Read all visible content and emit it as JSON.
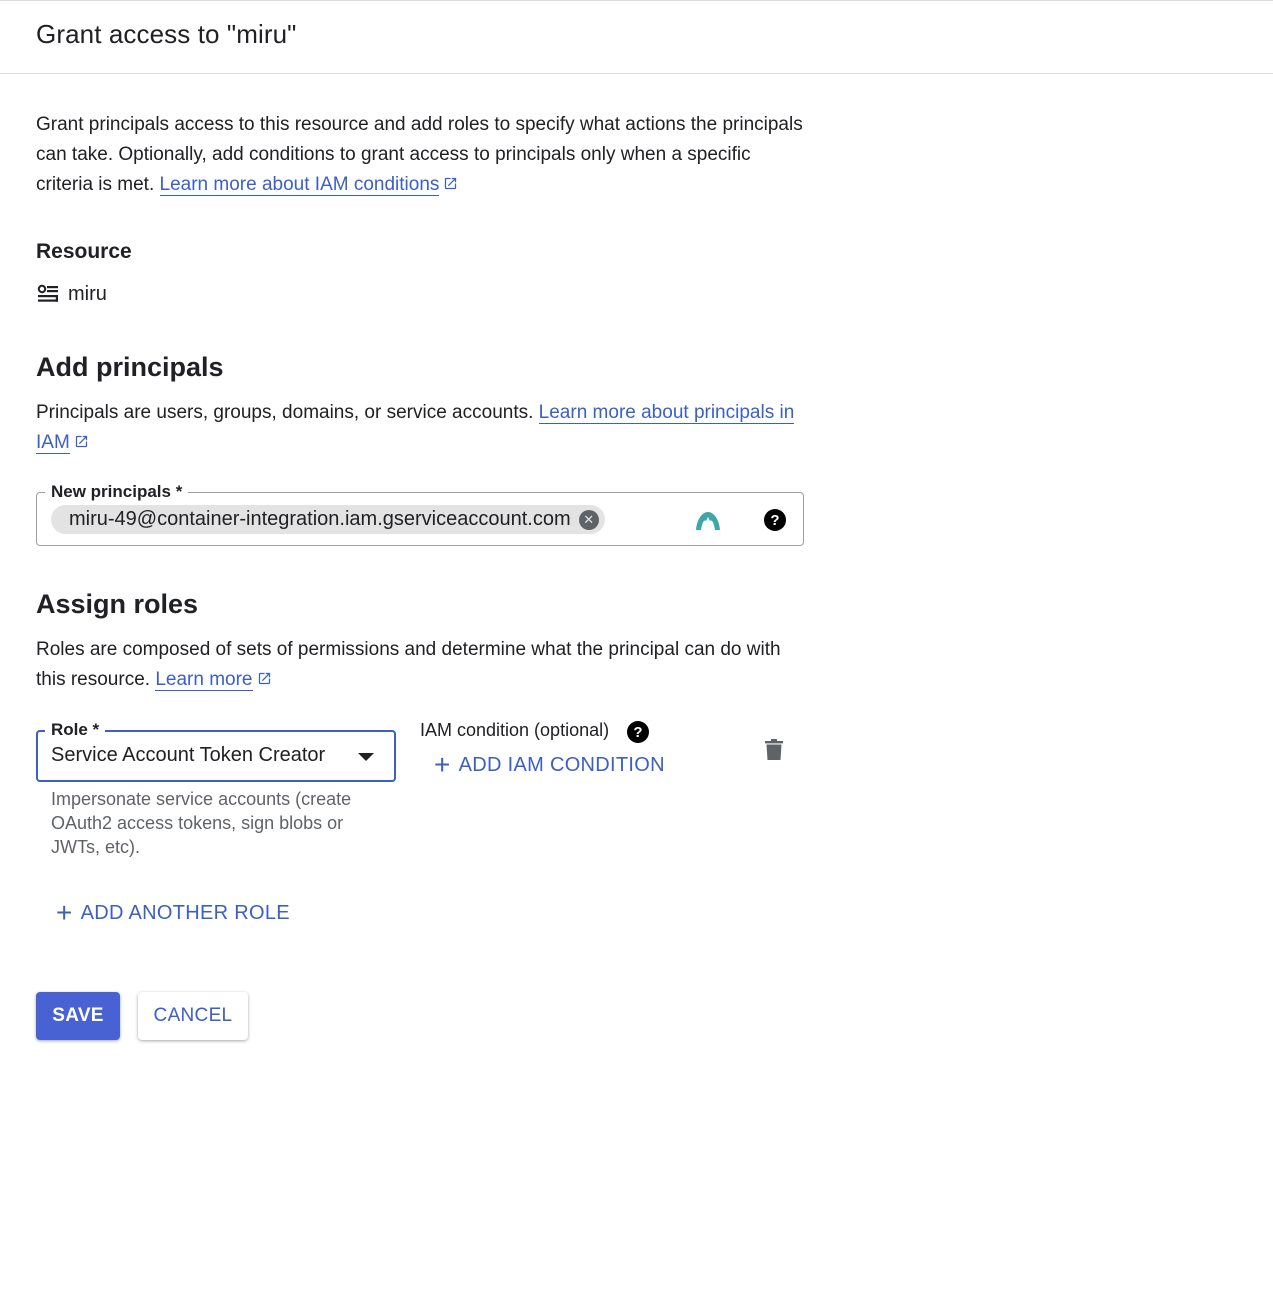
{
  "dialog": {
    "title": "Grant access to \"miru\""
  },
  "intro": {
    "text": "Grant principals access to this resource and add roles to specify what actions the principals can take. Optionally, add conditions to grant access to principals only when a specific criteria is met.",
    "link": "Learn more about IAM conditions"
  },
  "resource": {
    "label": "Resource",
    "name": "miru",
    "icon": "service-account-icon"
  },
  "principals": {
    "title": "Add principals",
    "text": "Principals are users, groups, domains, or service accounts.",
    "link": "Learn more about principals in IAM",
    "field_label": "New principals *",
    "chips": [
      "miru-49@container-integration.iam.gserviceaccount.com"
    ]
  },
  "roles": {
    "title": "Assign roles",
    "text": "Roles are composed of sets of permissions and determine what the principal can do with this resource.",
    "link": "Learn more",
    "role_label": "Role *",
    "role_value": "Service Account Token Creator",
    "role_hint": "Impersonate service accounts (create OAuth2 access tokens, sign blobs or JWTs, etc).",
    "condition_label": "IAM condition (optional)",
    "add_condition": "ADD IAM CONDITION",
    "add_role": "ADD ANOTHER ROLE"
  },
  "actions": {
    "save": "SAVE",
    "cancel": "CANCEL"
  },
  "colors": {
    "accent": "#3b5fc4",
    "primary_button": "#4862d4"
  }
}
